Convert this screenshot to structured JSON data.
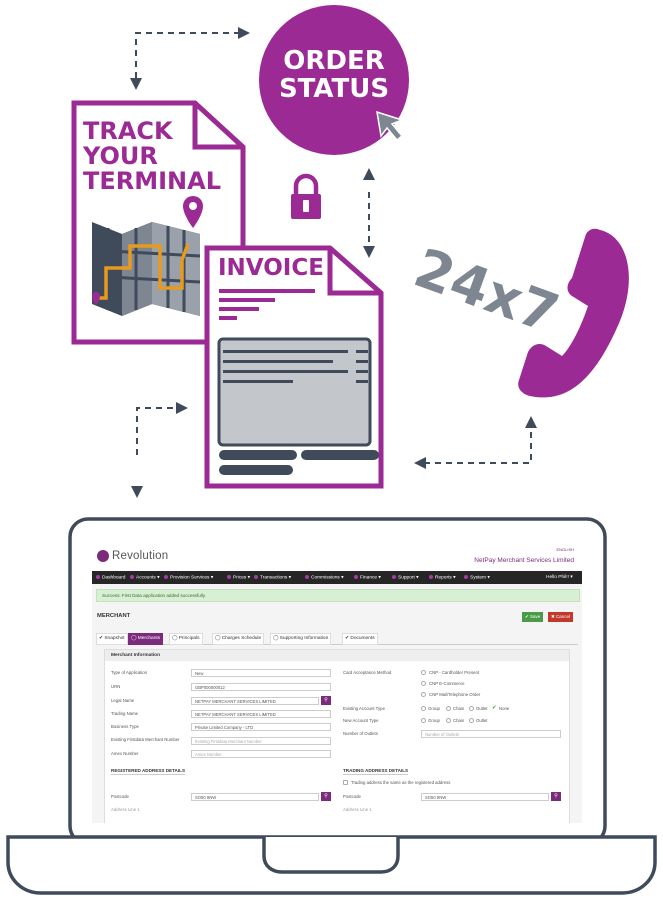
{
  "illustration": {
    "order_status": {
      "line1": "ORDER",
      "line2": "STATUS"
    },
    "track_terminal": {
      "line1": "TRACK",
      "line2": "YOUR",
      "line3": "TERMINAL"
    },
    "invoice_title": "INVOICE",
    "support_text": "24x7",
    "colors": {
      "purple": "#9b2a94",
      "slate": "#3f4a5a",
      "gray": "#7d8691",
      "map_orange": "#e79a1c"
    }
  },
  "app": {
    "logo": "Revolution",
    "language": "ENGLISH",
    "company": "NetPay Merchant Services Limited",
    "nav": [
      {
        "label": "Dashboard"
      },
      {
        "label": "Accounts ▾"
      },
      {
        "label": "Provision Services ▾"
      },
      {
        "label": "Prices ▾"
      },
      {
        "label": "Transactions ▾"
      },
      {
        "label": "Commissions ▾"
      },
      {
        "label": "Finance ▾"
      },
      {
        "label": "Support ▾"
      },
      {
        "label": "Reports ▾"
      },
      {
        "label": "System ▾"
      }
    ],
    "user": "Hello Phil!! ▾",
    "alert": "Success: First Data application added successfully",
    "page_title": "MERCHANT",
    "save_label": "✔ Save",
    "cancel_label": "✖ Cancel",
    "tabs": [
      "✔ Snapshot",
      "◯ Merchants",
      "◯ Principals",
      "◯ Charges Schedule",
      "◯ Supporting Information",
      "✔ Documents"
    ],
    "panel_title": "Merchant Information",
    "fields": {
      "type_label": "Type of Application",
      "type_value": "New",
      "urn_label": "URN",
      "urn_value": "GBP000000012",
      "legal_label": "Legal Name",
      "legal_value": "NETPAY MERCHANT SERVICES LIMITED",
      "trading_label": "Trading Name",
      "trading_value": "NETPAY MERCHANT SERVICES LIMITED",
      "business_label": "Business Type",
      "business_value": "Private Limited Company - LTD",
      "firstdata_label": "Existing Firstdata Merchant Number",
      "firstdata_placeholder": "Existing Firstdata Merchant Number",
      "amex_label": "Amex Number",
      "amex_placeholder": "Amex Number",
      "card_label": "Card Acceptance Method",
      "card_options": [
        "CNP - Cardholder Present",
        "CNP E-Commerce",
        "CNP Mail/Telephone Order"
      ],
      "existing_type_label": "Existing Account Type",
      "existing_type_options": [
        "Group",
        "Chain",
        "Outlet",
        "None"
      ],
      "new_type_label": "New Account Type",
      "new_type_options": [
        "Group",
        "Chain",
        "Outlet"
      ],
      "outlets_label": "Number of Outlets",
      "outlets_placeholder": "Number of Outlets"
    },
    "registered_title": "REGISTERED ADDRESS DETAILS",
    "trading_title": "TRADING ADDRESS DETAILS",
    "same_address": "Trading address the same as the registered address",
    "postcode_label": "Postcode",
    "postcode_value": "SO50 9NW",
    "address_line_label": "Address Line 1"
  }
}
